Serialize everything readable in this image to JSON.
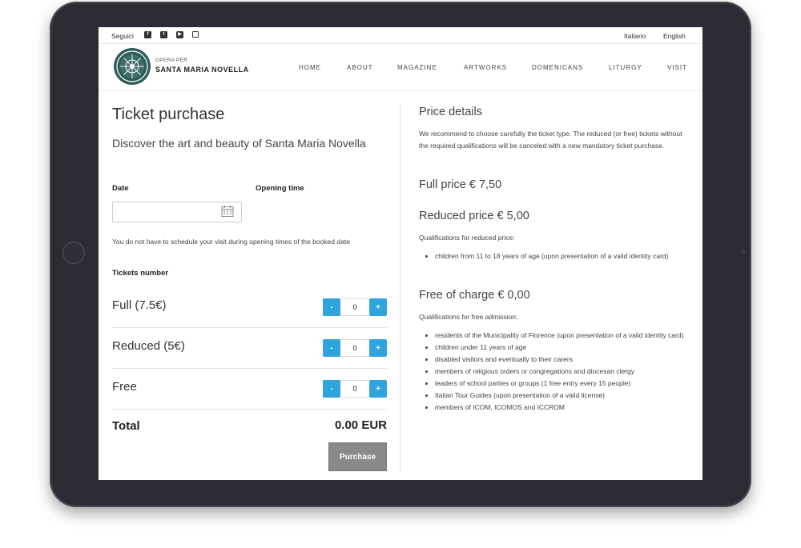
{
  "topbar": {
    "follow_label": "Seguici",
    "social_icons": [
      "facebook-icon",
      "twitter-icon",
      "youtube-icon",
      "instagram-icon"
    ],
    "languages": [
      "Italiano",
      "English"
    ]
  },
  "logo": {
    "small_text": "OPERA PER",
    "big_text": "SANTA MARIA NOVELLA"
  },
  "nav": {
    "items": [
      "HOME",
      "ABOUT",
      "MAGAZINE",
      "ARTWORKS",
      "DOMENICANS",
      "LITURGY",
      "VISIT"
    ]
  },
  "purchase": {
    "title": "Ticket purchase",
    "subtitle": "Discover the art and beauty of Santa Maria Novella",
    "date_label": "Date",
    "opening_time_label": "Opening time",
    "date_value": "",
    "note": "You do not have to schedule your visit during opening times of the booked date",
    "tickets_label": "Tickets number",
    "tickets": [
      {
        "name": "Full (7.5€)",
        "quantity": "0"
      },
      {
        "name": "Reduced (5€)",
        "quantity": "0"
      },
      {
        "name": "Free",
        "quantity": "0"
      }
    ],
    "minus_label": "-",
    "plus_label": "+",
    "total_label": "Total",
    "total_value": "0.00 EUR",
    "purchase_button": "Purchase"
  },
  "price_details": {
    "title": "Price details",
    "intro": "We recommend to choose carefully the ticket type. The reduced (or free) tickets without the required qualifications will be canceled with a new mandatory ticket purchase.",
    "full_price": "Full price € 7,50",
    "reduced_price": "Reduced price € 5,00",
    "reduced_qualifications_label": "Qualifications for reduced price:",
    "reduced_qualifications": [
      "children from 11 to 18 years of age (upon presentation of a valid identity card)"
    ],
    "free_price": "Free of charge € 0,00",
    "free_qualifications_label": "Qualifications for free admission:",
    "free_qualifications": [
      "residents of the Municipality of Florence (upon presentation of a valid identity card)",
      "children under 11 years of age",
      "disabled visitors and eventually to their carers",
      "members of religious orders or congregations and diocesan clergy",
      "leaders of school parties or groups (1 free entry every 15 people)",
      "Italian Tour Guides (upon presentation of a valid license)",
      "members of ICOM, ICOMOS and ICCROM"
    ]
  },
  "colors": {
    "accent": "#2ea6dd",
    "button_disabled": "#8a8a8a",
    "tablet_frame": "#2b2b33"
  }
}
